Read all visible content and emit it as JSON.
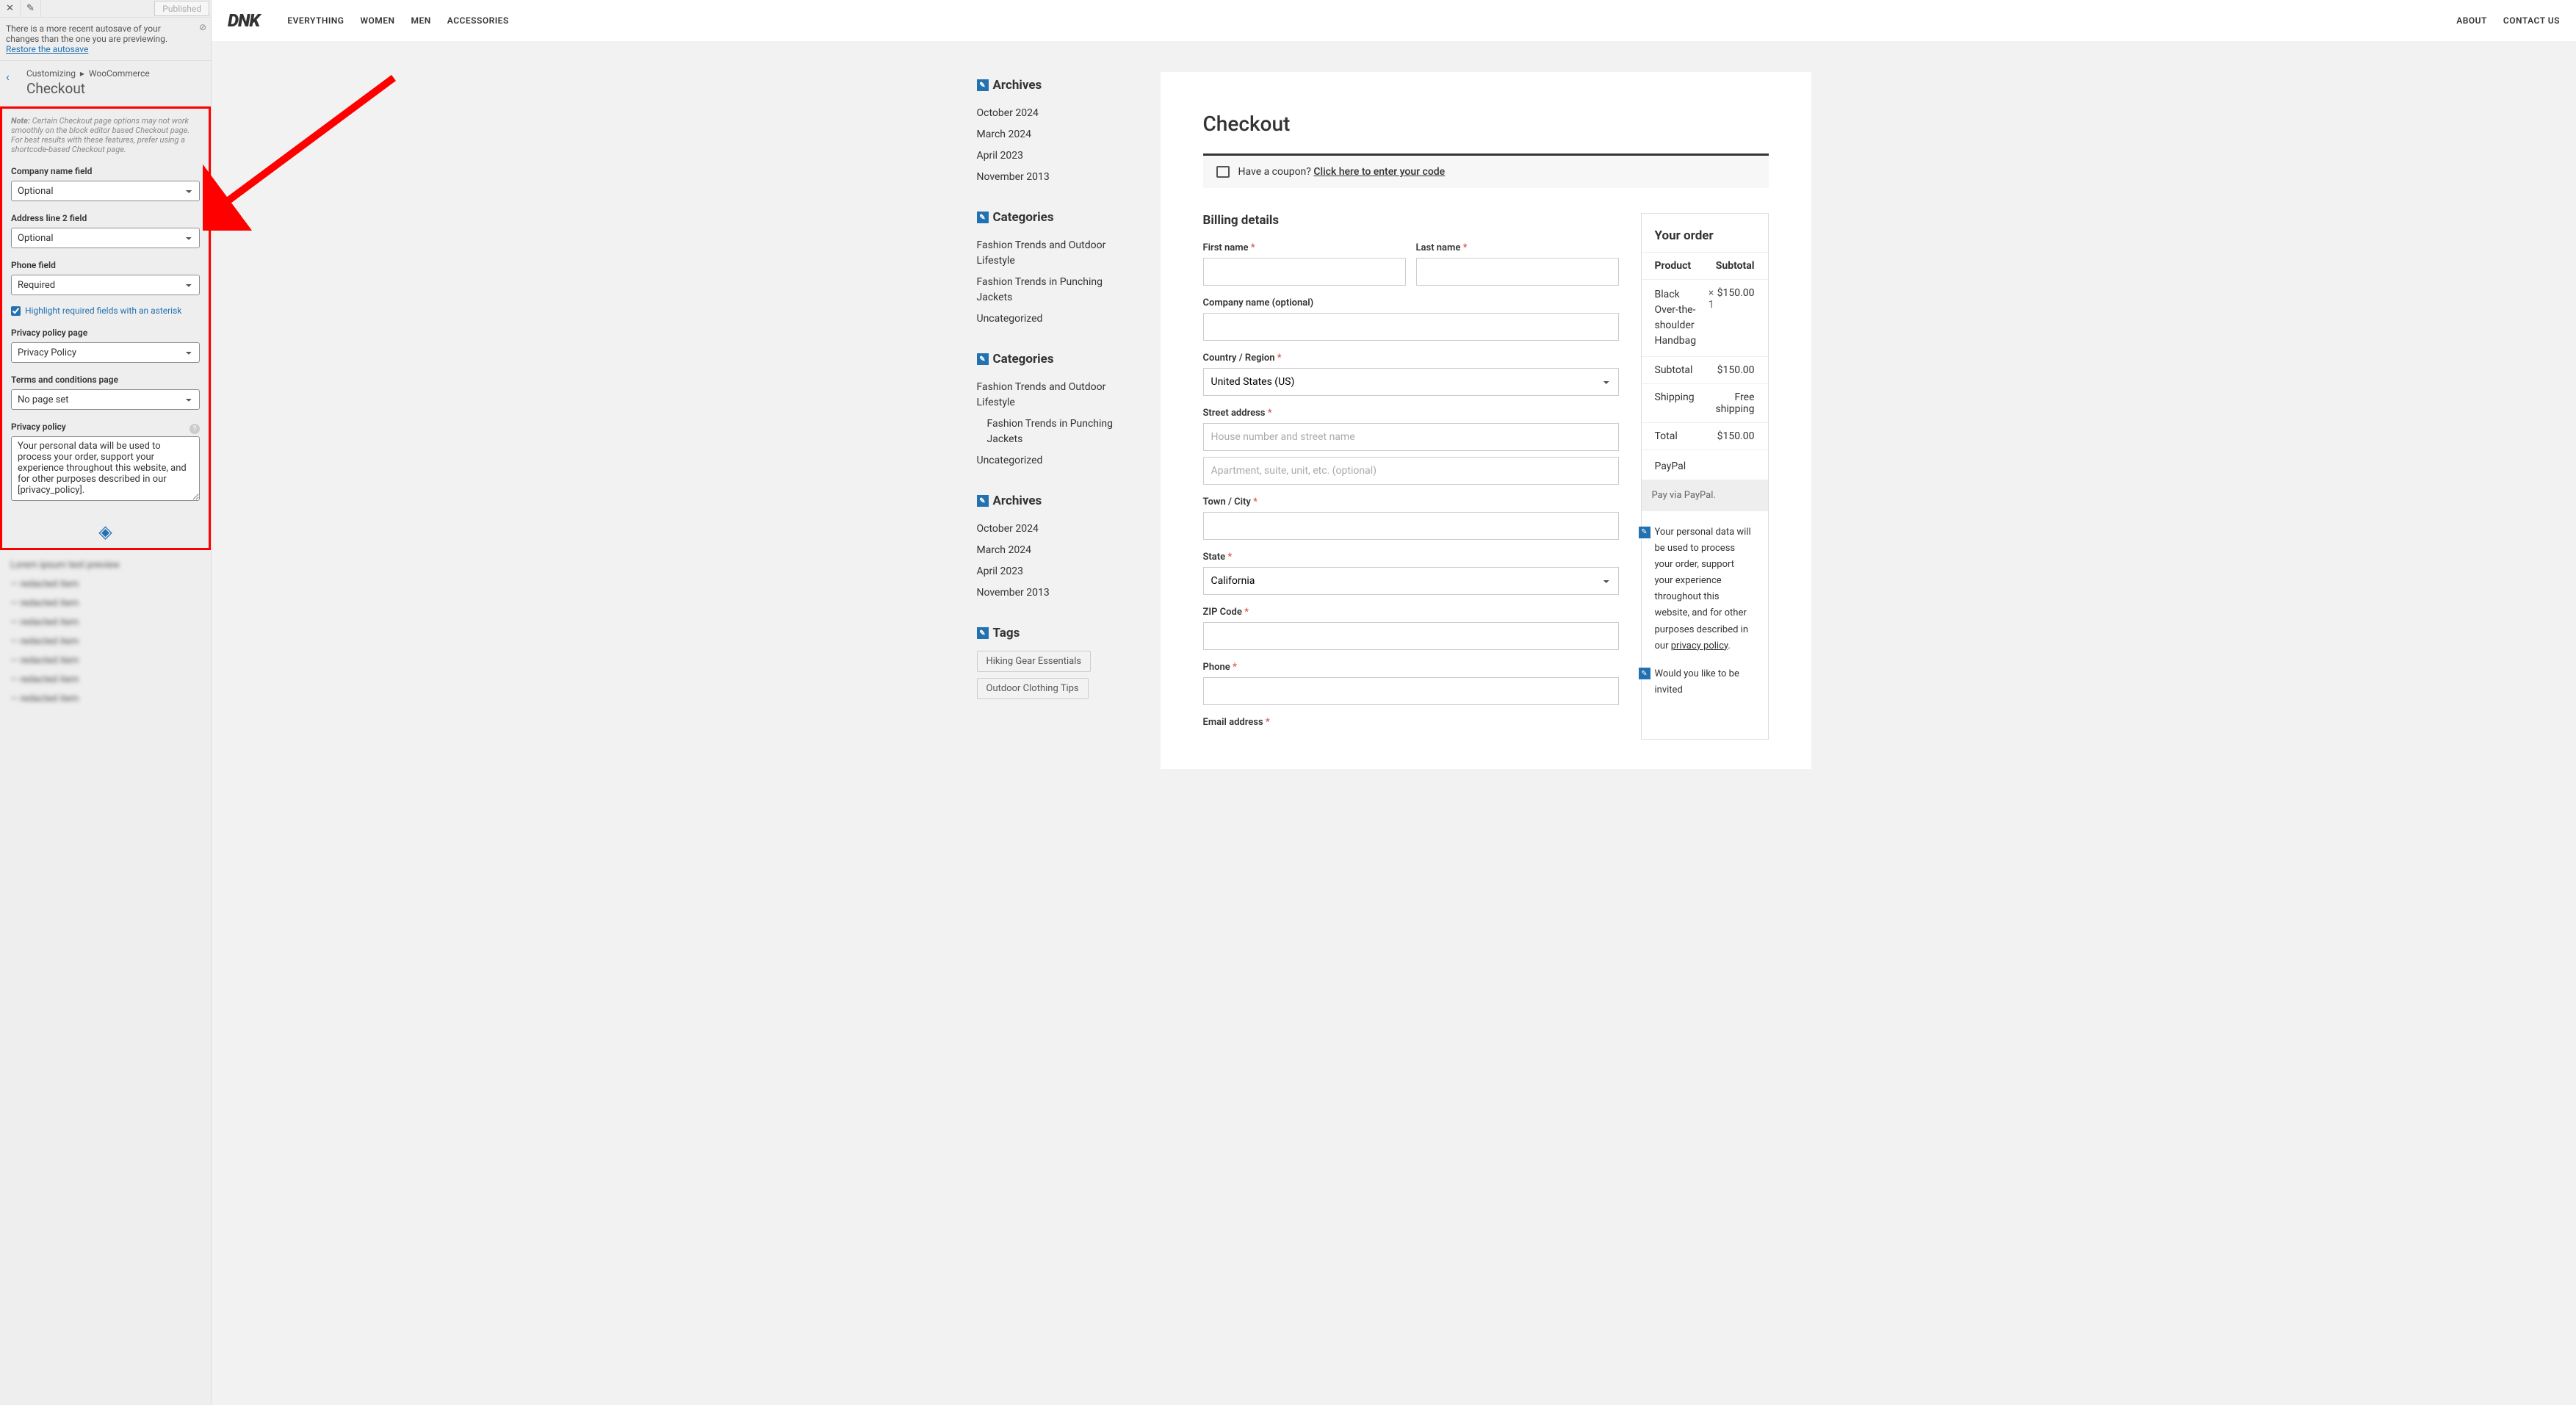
{
  "customizer": {
    "topbar": {
      "published": "Published"
    },
    "autosave": {
      "text_a": "There is a more recent autosave of your changes than the one you are previewing. ",
      "link": "Restore the autosave"
    },
    "breadcrumb": {
      "a": "Customizing",
      "sep": "▸",
      "b": "WooCommerce",
      "title": "Checkout"
    },
    "note_label": "Note:",
    "note": " Certain Checkout page options may not work smoothly on the block editor based Checkout page. For best results with these features, prefer using a shortcode-based Checkout page.",
    "fields": {
      "company_label": "Company name field",
      "company_value": "Optional",
      "addr2_label": "Address line 2 field",
      "addr2_value": "Optional",
      "phone_label": "Phone field",
      "phone_value": "Required",
      "highlight_label": "Highlight required fields with an asterisk",
      "privacy_page_label": "Privacy policy page",
      "privacy_page_value": "Privacy Policy",
      "terms_label": "Terms and conditions page",
      "terms_value": "No page set",
      "privacy_policy_label": "Privacy policy",
      "privacy_policy_value": "Your personal data will be used to process your order, support your experience throughout this website, and for other purposes described in our [privacy_policy]."
    }
  },
  "site": {
    "logo": "DNK",
    "nav": [
      "EVERYTHING",
      "WOMEN",
      "MEN",
      "ACCESSORIES"
    ],
    "nav2": [
      "ABOUT",
      "CONTACT US"
    ]
  },
  "sidebar": {
    "archives_title": "Archives",
    "archives": [
      "October 2024",
      "March 2024",
      "April 2023",
      "November 2013"
    ],
    "categories_title": "Categories",
    "categories": [
      "Fashion Trends and Outdoor Lifestyle",
      "Fashion Trends in Punching Jackets",
      "Uncategorized"
    ],
    "categories2_title": "Categories",
    "categories2": [
      "Fashion Trends and Outdoor Lifestyle",
      "Fashion Trends in Punching Jackets",
      "Uncategorized"
    ],
    "archives2_title": "Archives",
    "archives2": [
      "October 2024",
      "March 2024",
      "April 2023",
      "November 2013"
    ],
    "tags_title": "Tags",
    "tags": [
      "Hiking Gear Essentials",
      "Outdoor Clothing Tips"
    ]
  },
  "checkout": {
    "title": "Checkout",
    "coupon_q": "Have a coupon? ",
    "coupon_link": "Click here to enter your code",
    "billing_title": "Billing details",
    "fn": "First name",
    "ln": "Last name",
    "company": "Company name (optional)",
    "country": "Country / Region",
    "country_val": "United States (US)",
    "street": "Street address",
    "street_ph1": "House number and street name",
    "street_ph2": "Apartment, suite, unit, etc. (optional)",
    "town": "Town / City",
    "state": "State",
    "state_val": "California",
    "zip": "ZIP Code",
    "phone": "Phone",
    "email": "Email address",
    "req": "*"
  },
  "order": {
    "title": "Your order",
    "h_product": "Product",
    "h_subtotal": "Subtotal",
    "item_name": "Black Over-the-shoulder Handbag",
    "item_qty": "× 1",
    "item_price": "$150.00",
    "subtotal_l": "Subtotal",
    "subtotal_v": "$150.00",
    "ship_l": "Shipping",
    "ship_v": "Free shipping",
    "total_l": "Total",
    "total_v": "$150.00",
    "pay_label": "PayPal",
    "pay_desc": "Pay via PayPal.",
    "privacy_a": "Your personal data will be used to process your order, support your experience throughout this website, and for other purposes described in our ",
    "privacy_link": "privacy policy",
    "mailpoet": "Would you like to be invited"
  }
}
